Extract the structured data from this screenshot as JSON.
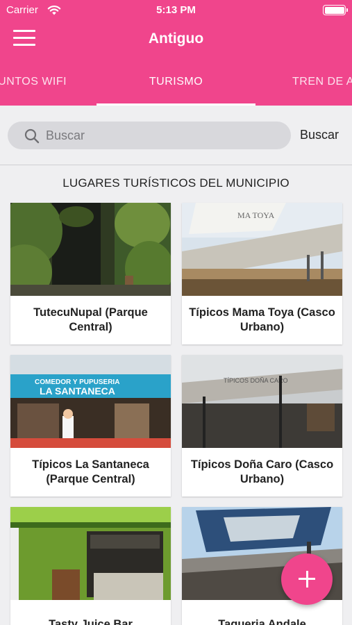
{
  "status_bar": {
    "carrier": "Carrier",
    "time": "5:13 PM"
  },
  "app_bar": {
    "title": "Antiguo"
  },
  "tabs": [
    {
      "label": "PUNTOS WIFI",
      "selected": false
    },
    {
      "label": "TURISMO",
      "selected": true
    },
    {
      "label": "TREN DE ASEO",
      "selected": false
    }
  ],
  "search": {
    "placeholder": "Buscar",
    "value": "",
    "button_label": "Buscar"
  },
  "section": {
    "title": "LUGARES TURÍSTICOS DEL MUNICIPIO"
  },
  "places": [
    {
      "name": "TutecuNupal (Parque Central)"
    },
    {
      "name": "Típicos Mama Toya (Casco Urbano)"
    },
    {
      "name": "Típicos La Santaneca (Parque Central)"
    },
    {
      "name": "Típicos Doña Caro (Casco Urbano)"
    },
    {
      "name": "Tasty Juice Bar"
    },
    {
      "name": "Taqueria Andale"
    }
  ],
  "image_signage": {
    "mama_toya": "MA TOYA",
    "santaneca_top": "COMEDOR Y PUPUSERIA",
    "santaneca_main": "LA SANTANECA",
    "dona_caro": "TÍPICOS DOÑA CARO"
  },
  "colors": {
    "primary": "#f0458c",
    "background": "#efeff1"
  }
}
